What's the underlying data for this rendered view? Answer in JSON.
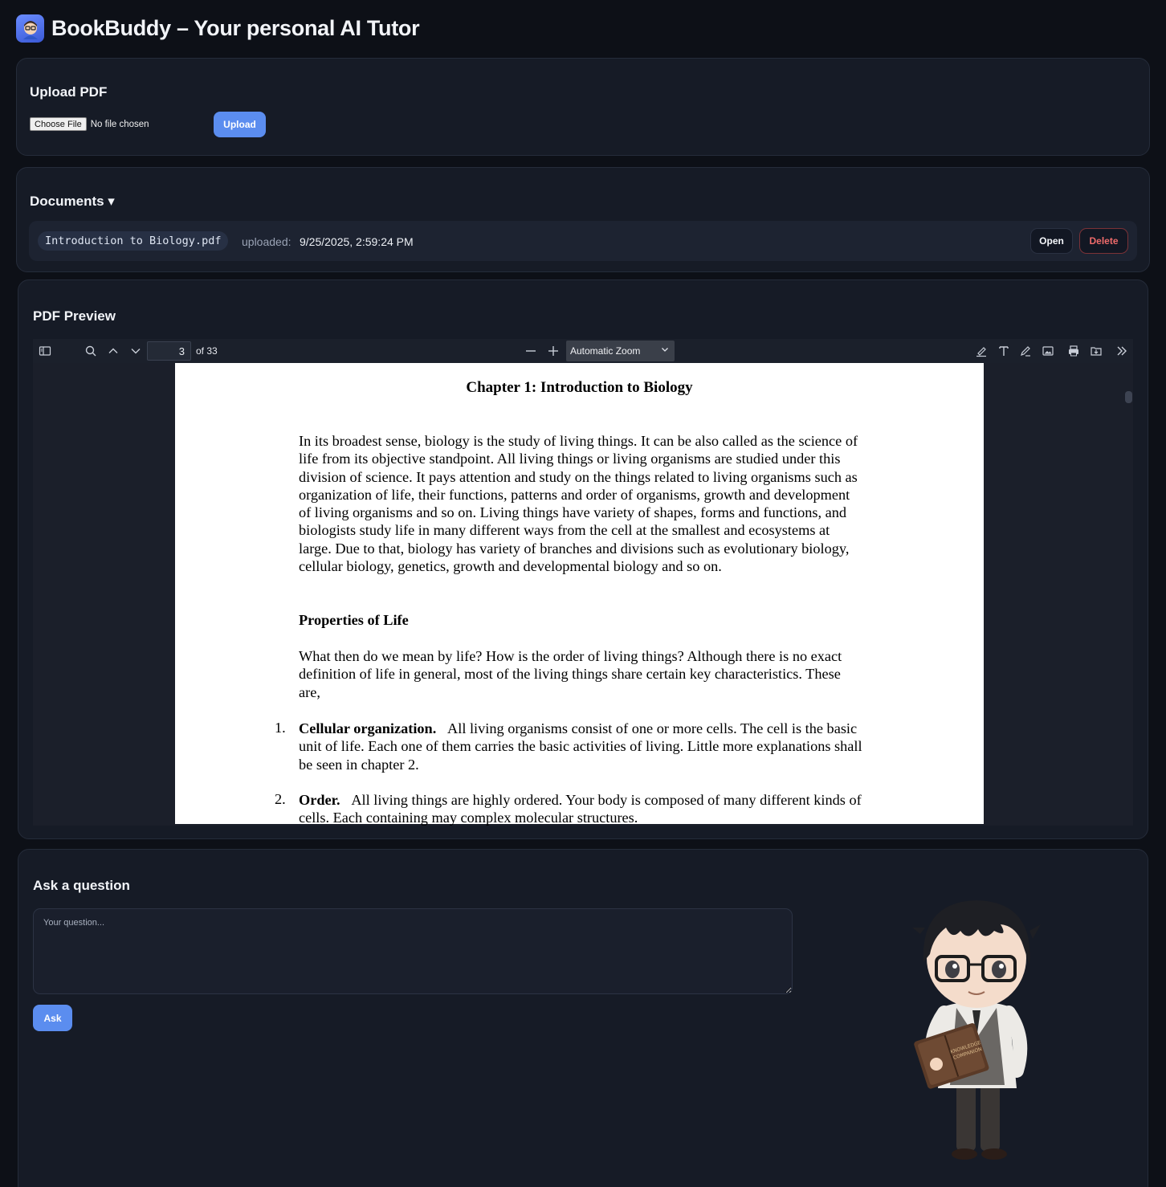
{
  "app": {
    "title": "BookBuddy – Your personal AI Tutor",
    "logo_icon": "student-avatar-icon"
  },
  "upload": {
    "title": "Upload PDF",
    "choose_file_label": "Choose File",
    "file_status": "No file chosen",
    "upload_label": "Upload"
  },
  "documents": {
    "title": "Documents ▾",
    "items": [
      {
        "name": "Introduction to Biology.pdf",
        "uploaded_label": "uploaded:",
        "uploaded_value": "9/25/2025, 2:59:24 PM",
        "open_label": "Open",
        "delete_label": "Delete"
      }
    ]
  },
  "preview": {
    "title": "PDF Preview",
    "toolbar": {
      "page_number": "3",
      "page_count": "of 33",
      "zoom": "Automatic Zoom"
    },
    "page": {
      "heading": "Chapter 1: Introduction to Biology",
      "para1": "In its broadest sense, biology is the study of living things. It can be also called as the science of life from its objective standpoint. All living things or living organisms are studied under this division of science. It pays attention and study on the things related to living organisms such as organization of life, their functions, patterns and order of organisms, growth and development of living organisms and so on. Living things have variety of shapes, forms and functions, and biologists study life in many different ways from the cell at the smallest and ecosystems at large. Due to that, biology has variety of branches and divisions such as evolutionary biology, cellular biology, genetics, growth and developmental biology and so on.",
      "subheading": "Properties of Life",
      "para2": "What then do we mean by life? How is the order of living things? Although there is no exact definition of life in general, most of the living things share certain key characteristics. These are,",
      "list": [
        {
          "num": "1.",
          "term": "Cellular organization.",
          "text": "All living organisms consist of one or more cells. The cell is the basic unit of life. Each one of them carries the basic activities of living. Little more explanations shall be seen in chapter 2."
        },
        {
          "num": "2.",
          "term": "Order.",
          "text": "All living things are highly ordered. Your body is composed of many different kinds of cells. Each containing may complex molecular structures."
        }
      ]
    }
  },
  "ask": {
    "title": "Ask a question",
    "placeholder": "Your question...",
    "ask_label": "Ask",
    "mascot_book_text": "KNOWLEDGE COMPANION"
  },
  "colors": {
    "background": "#0d1017",
    "card": "#161b26",
    "accent": "#5b8def",
    "danger": "#ef6b6b"
  }
}
